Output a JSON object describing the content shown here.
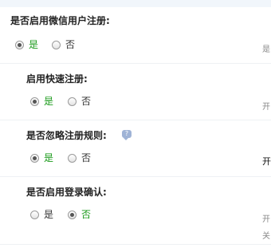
{
  "sections": [
    {
      "title": "是否启用微信用户注册:",
      "options": [
        {
          "label": "是",
          "selected": true,
          "label_color": "#1a9a1a"
        },
        {
          "label": "否",
          "selected": false,
          "label_color": "#333333"
        }
      ],
      "hint": "是"
    },
    {
      "title": "启用快速注册:",
      "options": [
        {
          "label": "是",
          "selected": true,
          "label_color": "#1a9a1a"
        },
        {
          "label": "否",
          "selected": false,
          "label_color": "#333333"
        }
      ],
      "hint": "开"
    },
    {
      "title": "是否忽略注册规则:",
      "help_icon": "?",
      "options": [
        {
          "label": "是",
          "selected": true,
          "label_color": "#1a9a1a"
        },
        {
          "label": "否",
          "selected": false,
          "label_color": "#333333"
        }
      ],
      "hint": "开"
    },
    {
      "title": "是否启用登录确认:",
      "options": [
        {
          "label": "是",
          "selected": false,
          "label_color": "#333333"
        },
        {
          "label": "否",
          "selected": true,
          "label_color": "#1a9a1a"
        }
      ],
      "hint_lines": [
        "开",
        "关"
      ]
    }
  ]
}
